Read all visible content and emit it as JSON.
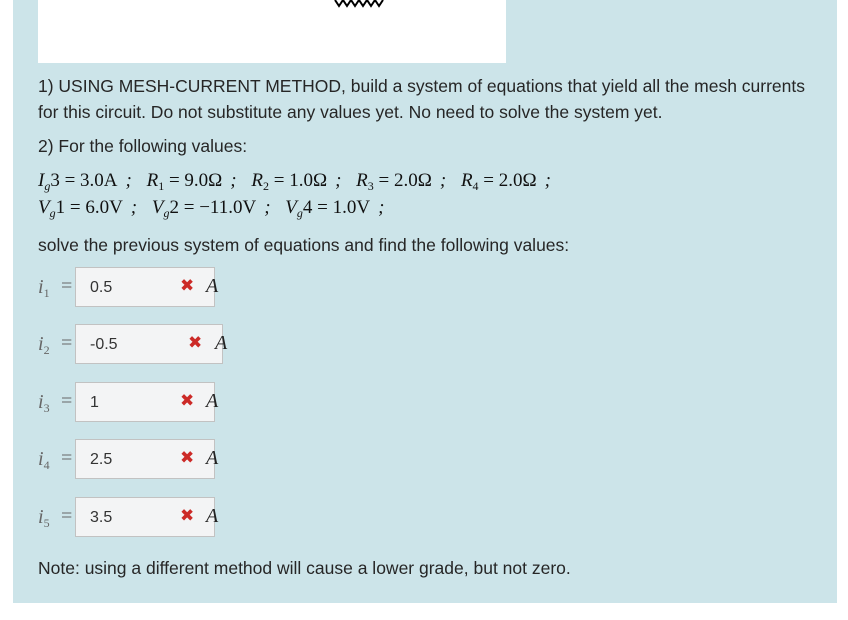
{
  "question": {
    "part1": "1) USING MESH-CURRENT METHOD, build a system of equations that yield all the mesh currents for this circuit. Do not substitute any values yet. No need to solve the system yet.",
    "part2": "2) For the following values:",
    "values_line1": [
      {
        "lhs": "I",
        "sub": "g",
        "rest": "3 = 3.0A"
      },
      {
        "lhs": "R",
        "sub": "1",
        "rest": " = 9.0Ω"
      },
      {
        "lhs": "R",
        "sub": "2",
        "rest": " = 1.0Ω"
      },
      {
        "lhs": "R",
        "sub": "3",
        "rest": " = 2.0Ω"
      },
      {
        "lhs": "R",
        "sub": "4",
        "rest": " = 2.0Ω"
      }
    ],
    "values_line2": [
      {
        "lhs": "V",
        "sub": "g",
        "rest": "1 = 6.0V"
      },
      {
        "lhs": "V",
        "sub": "g",
        "rest": "2 = −11.0V"
      },
      {
        "lhs": "V",
        "sub": "g",
        "rest": "4 = 1.0V"
      }
    ],
    "separator": ";",
    "solve_text": "solve the previous system of equations and find the following values:",
    "note": "Note: using a different method will cause a lower grade, but not zero."
  },
  "answers": [
    {
      "var": "i",
      "sub": "1",
      "value": "0.5",
      "status": "incorrect",
      "unit": "A"
    },
    {
      "var": "i",
      "sub": "2",
      "value": "-0.5",
      "status": "incorrect",
      "unit": "A"
    },
    {
      "var": "i",
      "sub": "3",
      "value": "1",
      "status": "incorrect",
      "unit": "A"
    },
    {
      "var": "i",
      "sub": "4",
      "value": "2.5",
      "status": "incorrect",
      "unit": "A"
    },
    {
      "var": "i",
      "sub": "5",
      "value": "3.5",
      "status": "incorrect",
      "unit": "A"
    }
  ],
  "equals": "=",
  "incorrect_mark": "✖"
}
